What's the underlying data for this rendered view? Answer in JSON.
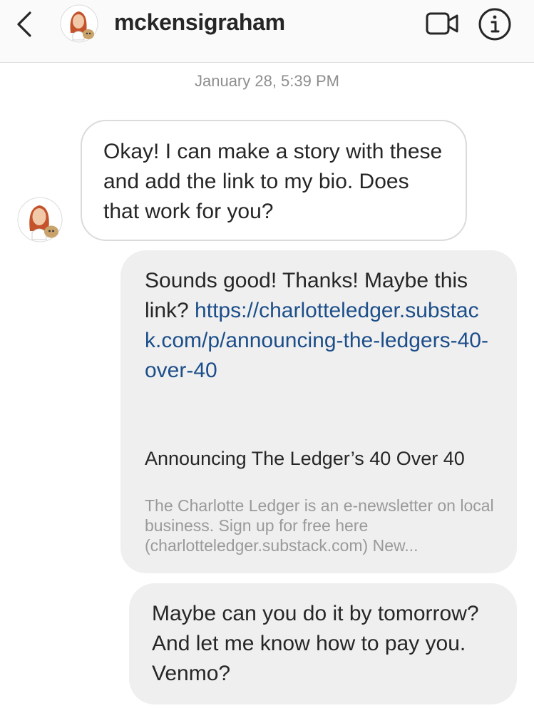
{
  "header": {
    "username": "mckensigraham",
    "icons": {
      "back": "chevron-left-icon",
      "video": "video-camera-icon",
      "info": "info-icon"
    }
  },
  "conversation": {
    "timestamp": "January 28, 5:39 PM",
    "messages": [
      {
        "direction": "incoming",
        "text": "Okay! I can make a story with these and add the link to my bio. Does that work for you?"
      },
      {
        "direction": "outgoing",
        "text": "Sounds good! Thanks! Maybe this link?",
        "link": "https://charlotteledger.substack.com/p/announcing-the-ledgers-40-over-40",
        "preview": {
          "title": "Announcing The Ledger’s 40 Over 40",
          "description": "The Charlotte Ledger is an e-newsletter on local business. Sign up for free here (charlotteledger.substack.com) New..."
        }
      },
      {
        "direction": "outgoing",
        "text": "Maybe can you do it by tomorrow? And let me know how to pay you. Venmo?"
      }
    ]
  },
  "colors": {
    "link": "#1c4e8a",
    "outgoing_bubble": "#efefef",
    "incoming_border": "#dbdbdb",
    "timestamp": "#8e8e8e"
  }
}
